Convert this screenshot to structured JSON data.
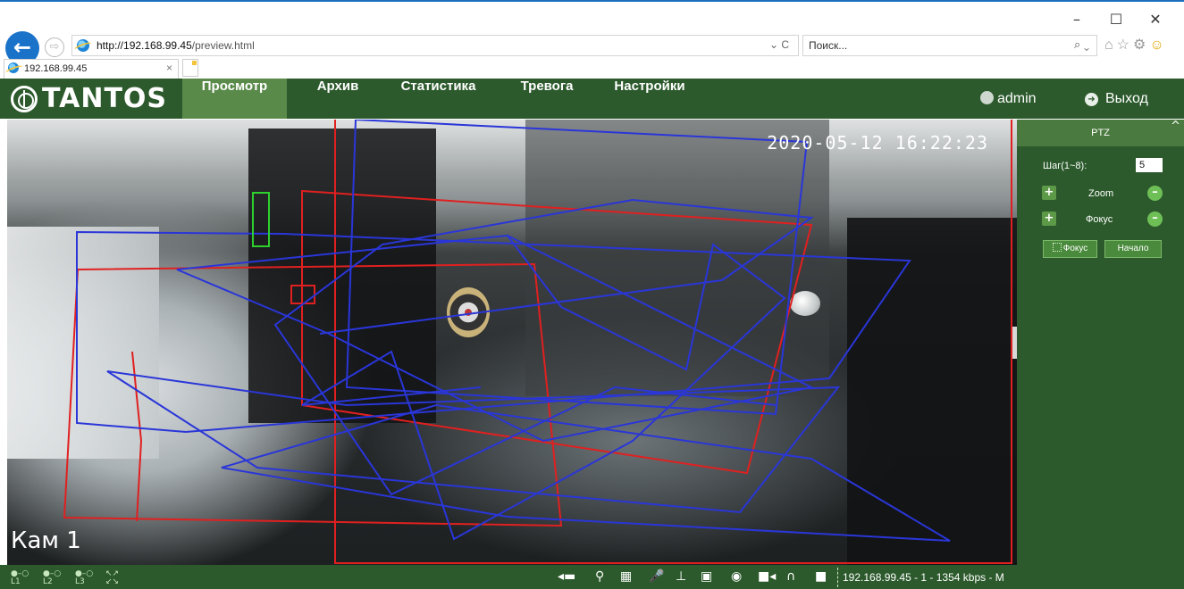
{
  "browser": {
    "url_host": "http://192.168.99.45",
    "url_path": "/preview.html",
    "reload_icon": "⌄ C",
    "search_placeholder": "Поиск...",
    "search_icon": "⌕ ⌄",
    "tab_title": "192.168.99.45",
    "tab_close": "×",
    "back": "←",
    "forward": "⇨",
    "window_controls": [
      "–",
      "☐",
      "✕"
    ],
    "toolbar_icons": [
      "home-icon",
      "star-icon",
      "gear-icon",
      "smiley-icon"
    ]
  },
  "header": {
    "logo_text": "TANTOS",
    "nav": [
      "Просмотр",
      "Архив",
      "Статистика",
      "Тревога",
      "Настройки"
    ],
    "active_tab": "Просмотр",
    "user": "admin",
    "logout": "Выход",
    "background": "#2c5a2c",
    "active_color": "#5a8a4a"
  },
  "video": {
    "timestamp": "2020-05-12 16:22:23",
    "camera_name": "Кам 1",
    "overlay_colors": {
      "red": "#e02020",
      "blue": "#2a36d8",
      "green": "#2ed02e"
    }
  },
  "ptz": {
    "title": "PTZ",
    "collapse_icon": "^",
    "step_label": "Шаг(1~8):",
    "step_value": "5",
    "zoom_label": "Zoom",
    "focus_label": "Фокус",
    "focus_button": "Фокус",
    "home_button": "Начало"
  },
  "bottom_bar": {
    "layouts": [
      {
        "top": "●–○",
        "bottom": "L1"
      },
      {
        "top": "●–○",
        "bottom": "L2"
      },
      {
        "top": "●–○",
        "bottom": "L3"
      },
      {
        "top": "↖↗",
        "bottom": "↙↘"
      }
    ],
    "tools": [
      "◂▬",
      "⚲",
      "▦",
      "🎤",
      "⊥",
      "▣",
      "◉",
      "■◂",
      "∩",
      "■"
    ],
    "status": "192.168.99.45 - 1 - 1354 kbps - M"
  }
}
